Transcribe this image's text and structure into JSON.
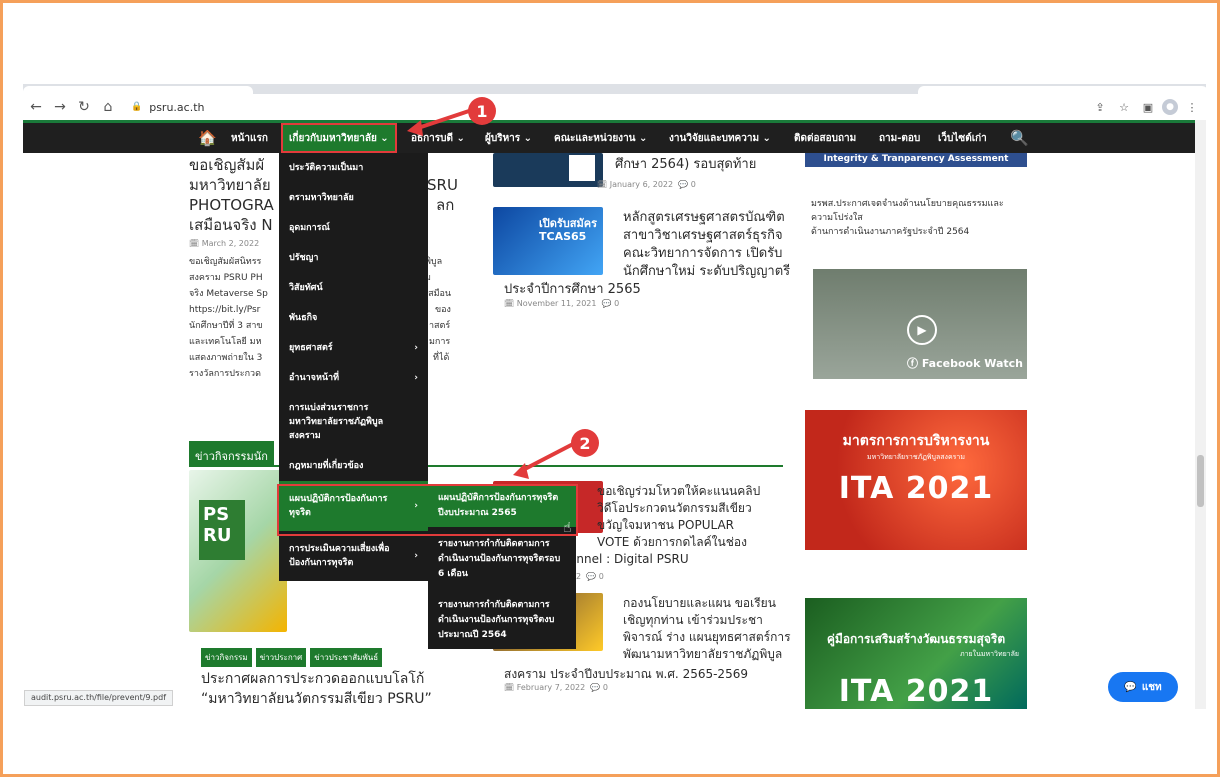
{
  "browser": {
    "url": "psru.ac.th",
    "status_url": "audit.psru.ac.th/file/prevent/9.pdf"
  },
  "menu": {
    "home": "หน้าแรก",
    "about": "เกี่ยวกับมหาวิทยาลัย",
    "president": "อธิการบดี",
    "executives": "ผู้บริหาร",
    "faculties": "คณะและหน่วยงาน",
    "research": "งานวิจัยและบทความ",
    "contact": "ติดต่อสอบถาม",
    "qa": "ถาม-ตอบ",
    "oldsite": "เว็บไซต์เก่า"
  },
  "dropdown": [
    "ประวัติความเป็นมา",
    "ตรามหาวิทยาลัย",
    "อุดมการณ์",
    "ปรัชญา",
    "วิสัยทัศน์",
    "พันธกิจ",
    "ยุทธศาสตร์",
    "อำนาจหน้าที่",
    "การแบ่งส่วนราชการมหาวิทยาลัยราชภัฏพิบูลสงคราม",
    "กฎหมายที่เกี่ยวข้อง",
    "แผนปฏิบัติการป้องกันการทุจริต",
    "การประเมินความเสี่ยงเพื่อป้องกันการทุจริต"
  ],
  "submenu": [
    "แผนปฏิบัติการป้องกันการทุจริตปีงบประมาณ 2565",
    "รายงานการกำกับติดตามการดำเนินงานป้องกันการทุจริตรอบ 6 เดือน",
    "รายงานการกำกับติดตามการดำเนินงานป้องกันการทุจริตงบประมาณปี 2564"
  ],
  "annotations": {
    "one": "1",
    "two": "2"
  },
  "left": {
    "headline": "ขอเชิญสัมผัส มหาวิทยาลัย PSRU PHOTOGRA...ลก เสมือนจริง M",
    "h1": "ขอเชิญสัมผั",
    "h2": "มหาวิทยาลัย",
    "h2b": "SRU",
    "h3": "PHOTOGRA",
    "h3b": "ลก",
    "h4": "เสมือนจริง N",
    "date": "March 2, 2022",
    "p1": "ขอเชิญสัมผัสนิทรร",
    "p1b": "พิบูล",
    "p2": "สงคราม PSRU PH",
    "p2b": "มเสมือน",
    "p3": "จริง Metaverse Sp",
    "p4": "https://bit.ly/Psr",
    "p4b": "ของ",
    "p5": "นักศึกษาปีที่ 3 สาข",
    "p5b": "าสตร์",
    "p6": "และเทคโนโลยี มห",
    "p6b": "มการ",
    "p7": "แสดงภาพถ่ายใน 3",
    "p7b": "ที่ได้",
    "p8": "รางวัลการประกวด",
    "section": "ข่าวกิจกรรมนัก",
    "tags": [
      "ข่าวกิจกรรม",
      "ข่าวประกาศ",
      "ข่าวประชาสัมพันธ์"
    ],
    "bottom1": "ประกาศผลการประกวดออกแบบโลโก้",
    "bottom2": "“มหาวิทยาลัยนวัตกรรมสีเขียว PSRU”"
  },
  "middle": {
    "top1": "ศึกษา 2564) รอบสุดท้าย",
    "top_date": "January 6, 2022",
    "top_comments": "0",
    "tcas_badge": "เปิดรับสมัคร TCAS65",
    "a1": "หลักสูตรเศรษฐศาสตรบัณฑิต",
    "a2": "สาขาวิชาเศรษฐศาสตร์ธุรกิจ",
    "a3": "คณะวิทยาการจัดการ เปิดรับ",
    "a4": "นักศึกษาใหม่ ระดับปริญญาตรี",
    "a5": "ประจำปีการศึกษา 2565",
    "a_date": "November 11, 2021",
    "a_comments": "0",
    "b1": "ขอเชิญร่วมโหวตให้คะแนนคลิป",
    "b2": "วิดีโอประกวดนวัตกรรมสีเขียว",
    "b3": "ขวัญใจมหาชน POPULAR",
    "b4": "VOTE ด้วยการกดไลค์ในช่อง",
    "b5": "annel : Digital PSRU",
    "b_date": "2",
    "b_comments": "0",
    "c1": "กองนโยบายและแผน ขอเรียน",
    "c2": "เชิญทุกท่าน เข้าร่วมประชา",
    "c3": "พิจารณ์ ร่าง แผนยุทธศาสตร์การ",
    "c4": "พัฒนามหาวิทยาลัยราชภัฏพิบูล",
    "c5": "สงคราม ประจำปีงบประมาณ พ.ศ. 2565-2569",
    "c_date": "February 7, 2022",
    "c_comments": "0"
  },
  "right": {
    "ita_header": "Integrity & Tranparency Assessment",
    "policy1": "มรพส.ประกาศเจตจำนงด้านนโยบายคุณธรรมและ",
    "policy2": "ความโปร่งใส",
    "policy3": "ด้านการดำเนินงานภาครัฐประจำปี 2564",
    "video_label": "Facebook Watch",
    "banner1_title": "มาตรการการบริหารงาน",
    "banner1_sub": "มหาวิทยาลัยราชภัฏพิบูลสงคราม",
    "banner1_ita": "ITA 2021",
    "banner2_title": "คู่มือการเสริมสร้างวัฒนธรรมสุจริต",
    "banner2_sub": "ภายในมหาวิทยาลัย",
    "banner2_ita": "ITA 2021"
  },
  "chat": "แชท"
}
